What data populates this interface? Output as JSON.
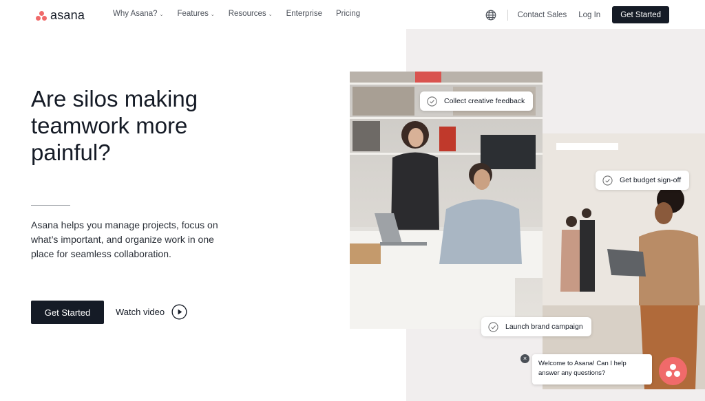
{
  "brand": {
    "name": "asana",
    "color": "#f06a6a"
  },
  "nav": {
    "menu": [
      {
        "label": "Why Asana?",
        "dropdown": true
      },
      {
        "label": "Features",
        "dropdown": true
      },
      {
        "label": "Resources",
        "dropdown": true
      },
      {
        "label": "Enterprise",
        "dropdown": false
      },
      {
        "label": "Pricing",
        "dropdown": false
      }
    ],
    "contact_label": "Contact Sales",
    "login_label": "Log In",
    "cta_label": "Get Started"
  },
  "hero": {
    "title": "Are silos making teamwork more painful?",
    "subtitle": "Asana helps you manage projects, focus on what’s important, and organize work in one place for seamless collaboration.",
    "primary_label": "Get Started",
    "watch_label": "Watch video"
  },
  "tags": {
    "feedback": "Collect creative feedback",
    "budget": "Get budget sign-off",
    "launch": "Launch brand campaign"
  },
  "chat": {
    "message": "Welcome to Asana! Can I help answer any questions?",
    "close_glyph": "×"
  },
  "colors": {
    "dark": "#151b26",
    "panel": "#f1eeee",
    "accent": "#f06a6a"
  }
}
